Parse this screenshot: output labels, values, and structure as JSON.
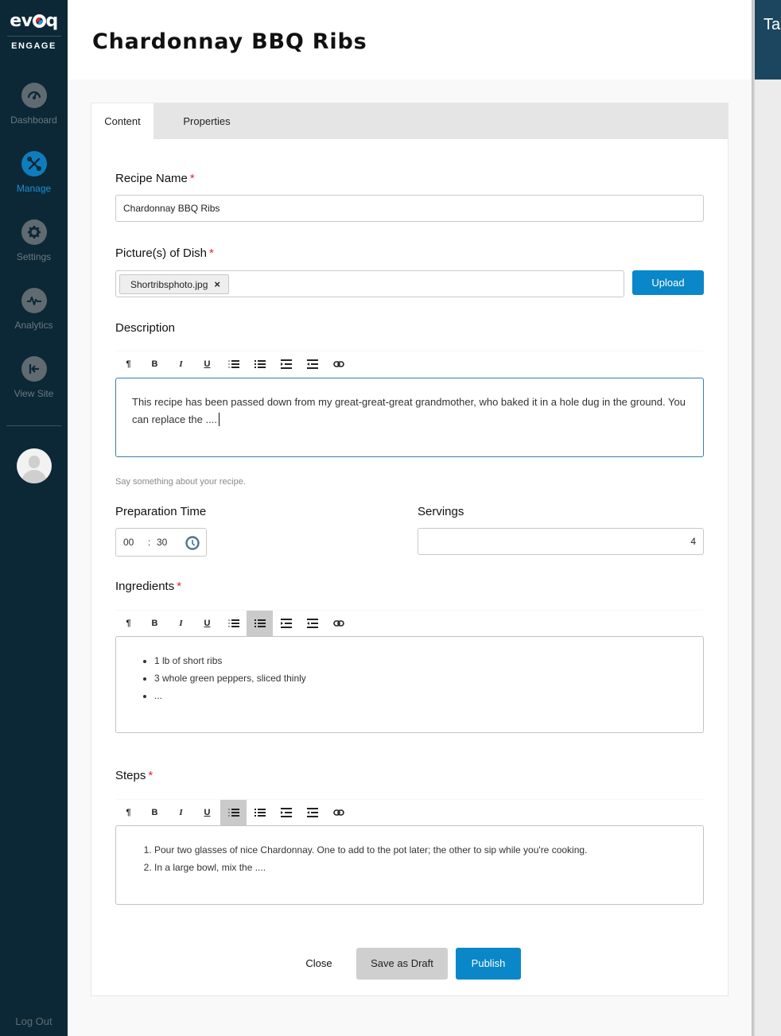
{
  "sidebar": {
    "logo_text": "evoq",
    "logo_subtext": "ENGAGE",
    "items": [
      {
        "label": "Dashboard",
        "icon": "dashboard-gauge-icon",
        "active": false
      },
      {
        "label": "Manage",
        "icon": "wrench-screwdriver-icon",
        "active": true
      },
      {
        "label": "Settings",
        "icon": "gear-icon",
        "active": false
      },
      {
        "label": "Analytics",
        "icon": "pulse-icon",
        "active": false
      },
      {
        "label": "View Site",
        "icon": "arrow-left-bar-icon",
        "active": false
      }
    ],
    "avatar": "user-avatar-icon",
    "logout_label": "Log Out"
  },
  "header": {
    "title": "Chardonnay BBQ Ribs"
  },
  "right_panel": {
    "title_fragment": "Ta"
  },
  "tabs": [
    {
      "label": "Content",
      "active": true
    },
    {
      "label": "Properties",
      "active": false
    }
  ],
  "form": {
    "recipe_name": {
      "label": "Recipe Name",
      "required": "*",
      "value": "Chardonnay BBQ Ribs"
    },
    "pictures": {
      "label": "Picture(s) of Dish",
      "required": "*",
      "files": [
        "Shortribsphoto.jpg"
      ],
      "remove_icon": "×",
      "upload_label": "Upload"
    },
    "description": {
      "label": "Description",
      "text": "This recipe has been passed down from my great-great-great grandmother, who baked it in a hole dug in the ground. You can replace the ....",
      "help": "Say something about your recipe."
    },
    "prep_time": {
      "label": "Preparation Time",
      "hours": "00",
      "separator": ":",
      "minutes": "30"
    },
    "servings": {
      "label": "Servings",
      "value": "4"
    },
    "ingredients": {
      "label": "Ingredients",
      "required": "*",
      "items": [
        "1 lb of short ribs",
        "3 whole green peppers, sliced thinly",
        "..."
      ]
    },
    "steps": {
      "label": "Steps",
      "required": "*",
      "items": [
        "Pour two glasses of nice Chardonnay. One to add to the pot later; the other to sip while you're cooking.",
        "In a large bowl, mix the ...."
      ]
    }
  },
  "toolbar": {
    "paragraph": "¶",
    "bold": "B",
    "italic": "I",
    "underline": "U"
  },
  "footer": {
    "close_label": "Close",
    "draft_label": "Save as Draft",
    "publish_label": "Publish"
  },
  "colors": {
    "sidebar_bg": "#0c2836",
    "accent": "#0a87c8",
    "required": "#e0262c",
    "active_nav": "#1d8fd6"
  }
}
